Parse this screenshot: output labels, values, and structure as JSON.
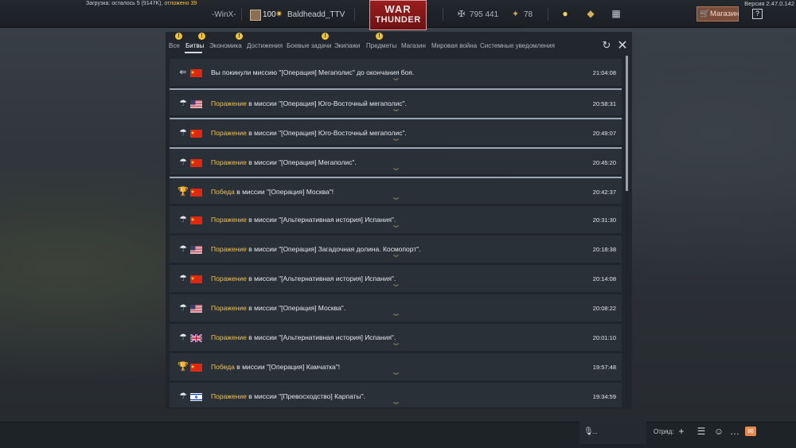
{
  "topbar": {
    "download_prefix": "Загрузка: осталось 5 (9147K), ",
    "download_highlight": "отложено 39",
    "version": "Версия 2.47.0.142",
    "squad_name": "-WinX-",
    "level": "100",
    "nickname": "Baldheadd_TTV",
    "logo_line1": "WAR",
    "logo_line2": "THUNDER",
    "silver_lions": "795 441",
    "golden_eagles": "78",
    "shop_label": "Магазин",
    "help_label": "?"
  },
  "dialog": {
    "tabs": [
      {
        "label": "Все",
        "badge": true
      },
      {
        "label": "Битвы",
        "badge": true,
        "active": true
      },
      {
        "label": "Экономика",
        "badge": true
      },
      {
        "label": "Достижения",
        "badge": false
      },
      {
        "label": "Боевые задачи",
        "badge": true
      },
      {
        "label": "Экипажи",
        "badge": false
      },
      {
        "label": "Предметы",
        "badge": true
      },
      {
        "label": "Магазин",
        "badge": false
      },
      {
        "label": "Мировая война",
        "badge": false
      },
      {
        "label": "Системные уведомления",
        "badge": false
      }
    ],
    "badge_symbol": "!",
    "notifications": [
      {
        "icon": "exit",
        "flag": "china",
        "result": "",
        "text": "Вы покинули миссию \"[Операция] Мегаполис\" до окончания боя.",
        "time": "21:04:08",
        "unread": false
      },
      {
        "icon": "parachute",
        "flag": "usa",
        "result": "Поражение",
        "text": " в миссии \"[Операция] Юго-Восточный мегаполис\".",
        "time": "20:58:31",
        "unread": true
      },
      {
        "icon": "parachute",
        "flag": "china",
        "result": "Поражение",
        "text": " в миссии \"[Операция] Юго-Восточный мегаполис\".",
        "time": "20:49:07",
        "unread": true
      },
      {
        "icon": "parachute",
        "flag": "china",
        "result": "Поражение",
        "text": " в миссии \"[Операция] Мегаполис\".",
        "time": "20:45:20",
        "unread": true
      },
      {
        "icon": "trophy",
        "flag": "china",
        "result": "Победа",
        "text": " в миссии \"[Операция] Москва\"!",
        "time": "20:42:37",
        "unread": true
      },
      {
        "icon": "parachute",
        "flag": "china",
        "result": "Поражение",
        "text": " в миссии \"[Альтернативная история] Испания\".",
        "time": "20:31:30",
        "unread": false
      },
      {
        "icon": "parachute",
        "flag": "usa",
        "result": "Поражение",
        "text": " в миссии \"[Операция] Загадочная долина. Космопорт\".",
        "time": "20:18:38",
        "unread": false
      },
      {
        "icon": "parachute",
        "flag": "china",
        "result": "Поражение",
        "text": " в миссии \"[Альтернативная история] Испания\".",
        "time": "20:14:08",
        "unread": false
      },
      {
        "icon": "parachute",
        "flag": "usa",
        "result": "Поражение",
        "text": " в миссии \"[Операция] Москва\".",
        "time": "20:08:22",
        "unread": false
      },
      {
        "icon": "parachute",
        "flag": "uk",
        "result": "Поражение",
        "text": " в миссии \"[Альтернативная история] Испания\".",
        "time": "20:01:10",
        "unread": false
      },
      {
        "icon": "trophy",
        "flag": "china",
        "result": "Победа",
        "text": " в миссии \"[Операция] Камчатка\"!",
        "time": "19:57:48",
        "unread": false
      },
      {
        "icon": "parachute",
        "flag": "israel",
        "result": "Поражение",
        "text": " в миссии \"[Превосходство] Карпаты\".",
        "time": "19:34:59",
        "unread": false
      }
    ]
  },
  "bottombar": {
    "voice_text": "...",
    "squad_label": "Отряд:"
  },
  "colors": {
    "accent_gold": "#f0c24a",
    "badge_yellow": "#f2c230",
    "logo_red": "#9a1d1d"
  }
}
